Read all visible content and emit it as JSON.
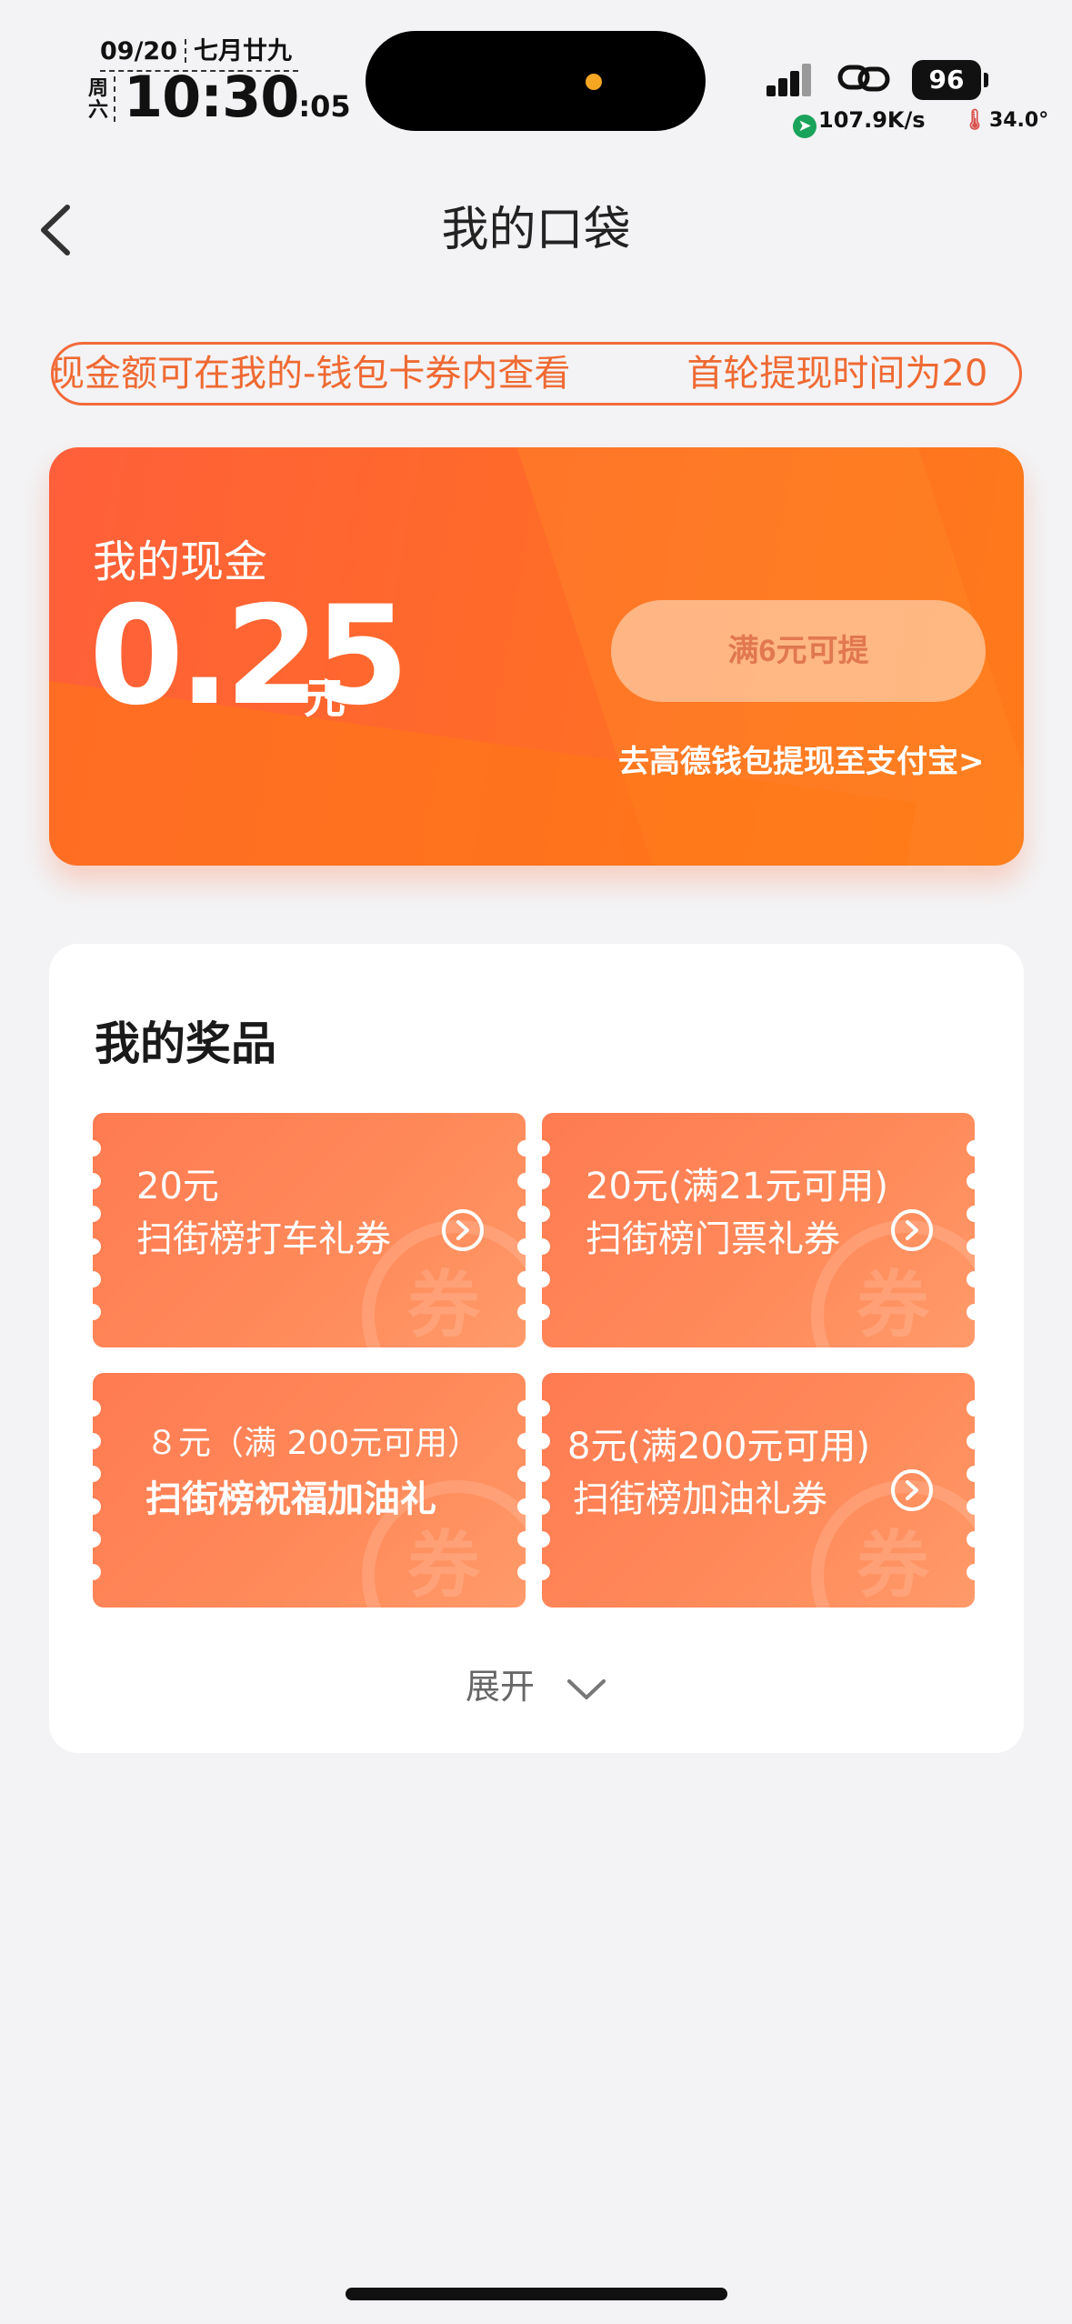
{
  "status_bar": {
    "date": "09/20",
    "lunar_date": "七月廿九",
    "weekday": "周六",
    "time": "10:30",
    "seconds": ":05",
    "battery": "96",
    "net_speed": "107.9K/s",
    "temperature": "34.0°"
  },
  "nav": {
    "title": "我的口袋"
  },
  "notice": {
    "text_1": "现金额可在我的-钱包卡券内查看",
    "text_2": "首轮提现时间为20"
  },
  "cash": {
    "label": "我的现金",
    "amount": "0.25",
    "unit": "元",
    "withdraw_button": "满6元可提",
    "wallet_link": "去高德钱包提现至支付宝>"
  },
  "prizes": {
    "title": "我的奖品",
    "coupon_watermark": "券",
    "items": [
      {
        "line1": "20元",
        "line2": "扫街榜打车礼券"
      },
      {
        "line1": "20元(满21元可用)",
        "line2": "扫街榜门票礼券"
      },
      {
        "line1": "８元（满 200元可用）",
        "line2": "扫街榜祝福加油礼"
      },
      {
        "line1": "8元(满200元可用)",
        "line2": "扫街榜加油礼券"
      }
    ],
    "expand_label": "展开"
  },
  "colors": {
    "accent": "#ff6a2a",
    "notice_text": "#ef6a32",
    "coupon": "#ff7b52"
  }
}
